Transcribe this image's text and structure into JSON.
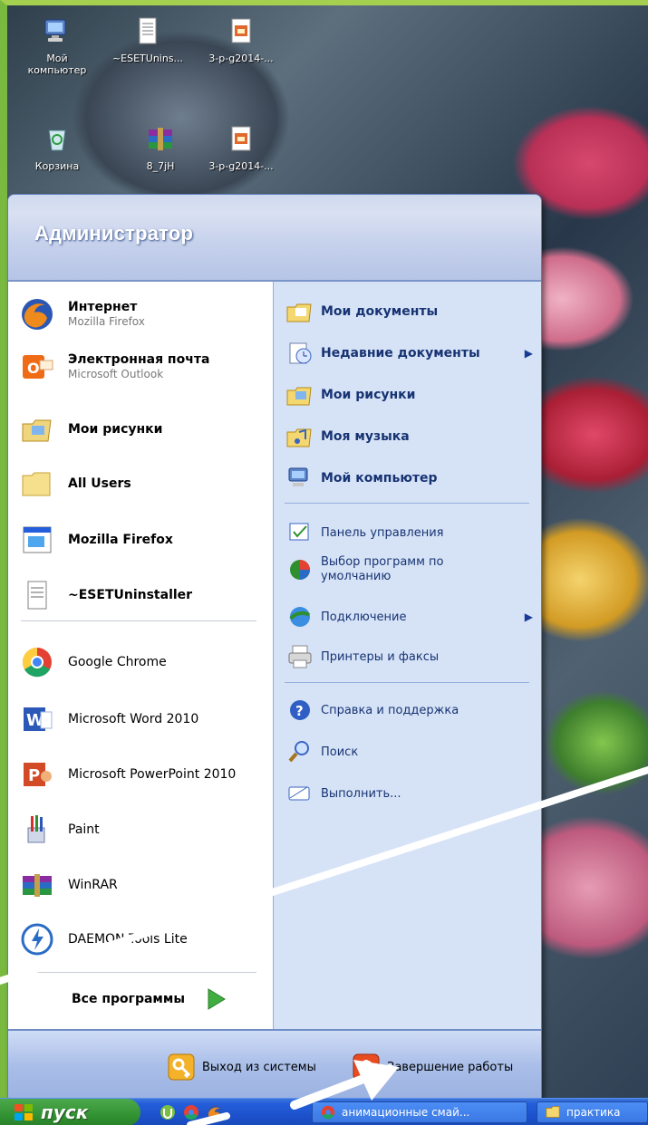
{
  "desktop": {
    "icons": [
      {
        "label": "Мой компьютер",
        "icon": "my-computer-icon"
      },
      {
        "label": "~ESETUnins...",
        "icon": "text-file-icon"
      },
      {
        "label": "3-p-g2014-...",
        "icon": "package-icon"
      },
      {
        "label": "Корзина",
        "icon": "recycle-bin-icon"
      },
      {
        "label": "8_7jH",
        "icon": "winrar-archive-icon"
      },
      {
        "label": "3-p-g2014-...",
        "icon": "package-icon"
      }
    ]
  },
  "start_menu": {
    "user": "Администратор",
    "left_pinned": [
      {
        "main": "Интернет",
        "sub": "Mozilla Firefox",
        "icon": "firefox-icon"
      },
      {
        "main": "Электронная почта",
        "sub": "Microsoft Outlook",
        "icon": "outlook-icon"
      }
    ],
    "left_recent": [
      {
        "main": "Мои рисунки",
        "icon": "my-pictures-icon"
      },
      {
        "main": "All Users",
        "icon": "folder-icon"
      },
      {
        "main": "Mozilla Firefox",
        "icon": "window-icon"
      },
      {
        "main": "~ESETUninstaller",
        "icon": "text-file-icon"
      },
      {
        "main": "Google Chrome",
        "icon": "chrome-icon"
      },
      {
        "main": "Microsoft Word 2010",
        "icon": "word-icon"
      },
      {
        "main": "Microsoft PowerPoint 2010",
        "icon": "powerpoint-icon"
      },
      {
        "main": "Paint",
        "icon": "paint-icon"
      },
      {
        "main": "WinRAR",
        "icon": "winrar-icon"
      },
      {
        "main": "DAEMON Tools Lite",
        "icon": "daemon-tools-icon"
      }
    ],
    "all_programs": "Все программы",
    "right_items": [
      {
        "label": "Мои документы",
        "bold": true,
        "icon": "my-documents-icon"
      },
      {
        "label": "Недавние документы",
        "bold": true,
        "icon": "recent-documents-icon",
        "arrow": true
      },
      {
        "label": "Мои рисунки",
        "bold": true,
        "icon": "my-pictures-icon"
      },
      {
        "label": "Моя музыка",
        "bold": true,
        "icon": "my-music-icon"
      },
      {
        "label": "Мой компьютер",
        "bold": true,
        "icon": "my-computer-icon"
      },
      {
        "label": "Панель управления",
        "icon": "control-panel-icon"
      },
      {
        "label": "Выбор программ по умолчанию",
        "icon": "default-programs-icon"
      },
      {
        "label": "Подключение",
        "icon": "connection-icon",
        "arrow": true
      },
      {
        "label": "Принтеры и факсы",
        "icon": "printer-icon"
      },
      {
        "label": "Справка и поддержка",
        "icon": "help-icon"
      },
      {
        "label": "Поиск",
        "icon": "search-icon"
      },
      {
        "label": "Выполнить...",
        "icon": "run-icon"
      }
    ],
    "logoff": "Выход из системы",
    "shutdown": "Завершение работы"
  },
  "taskbar": {
    "start": "пуск",
    "tasks": [
      {
        "label": "анимационные смай...",
        "icon": "chrome-icon"
      },
      {
        "label": "практика",
        "icon": "folder-icon"
      }
    ]
  },
  "colors": {
    "menu_blue": "#1f4dbd",
    "right_pane": "#d6e3f7",
    "start_green": "#2f8f2f"
  }
}
